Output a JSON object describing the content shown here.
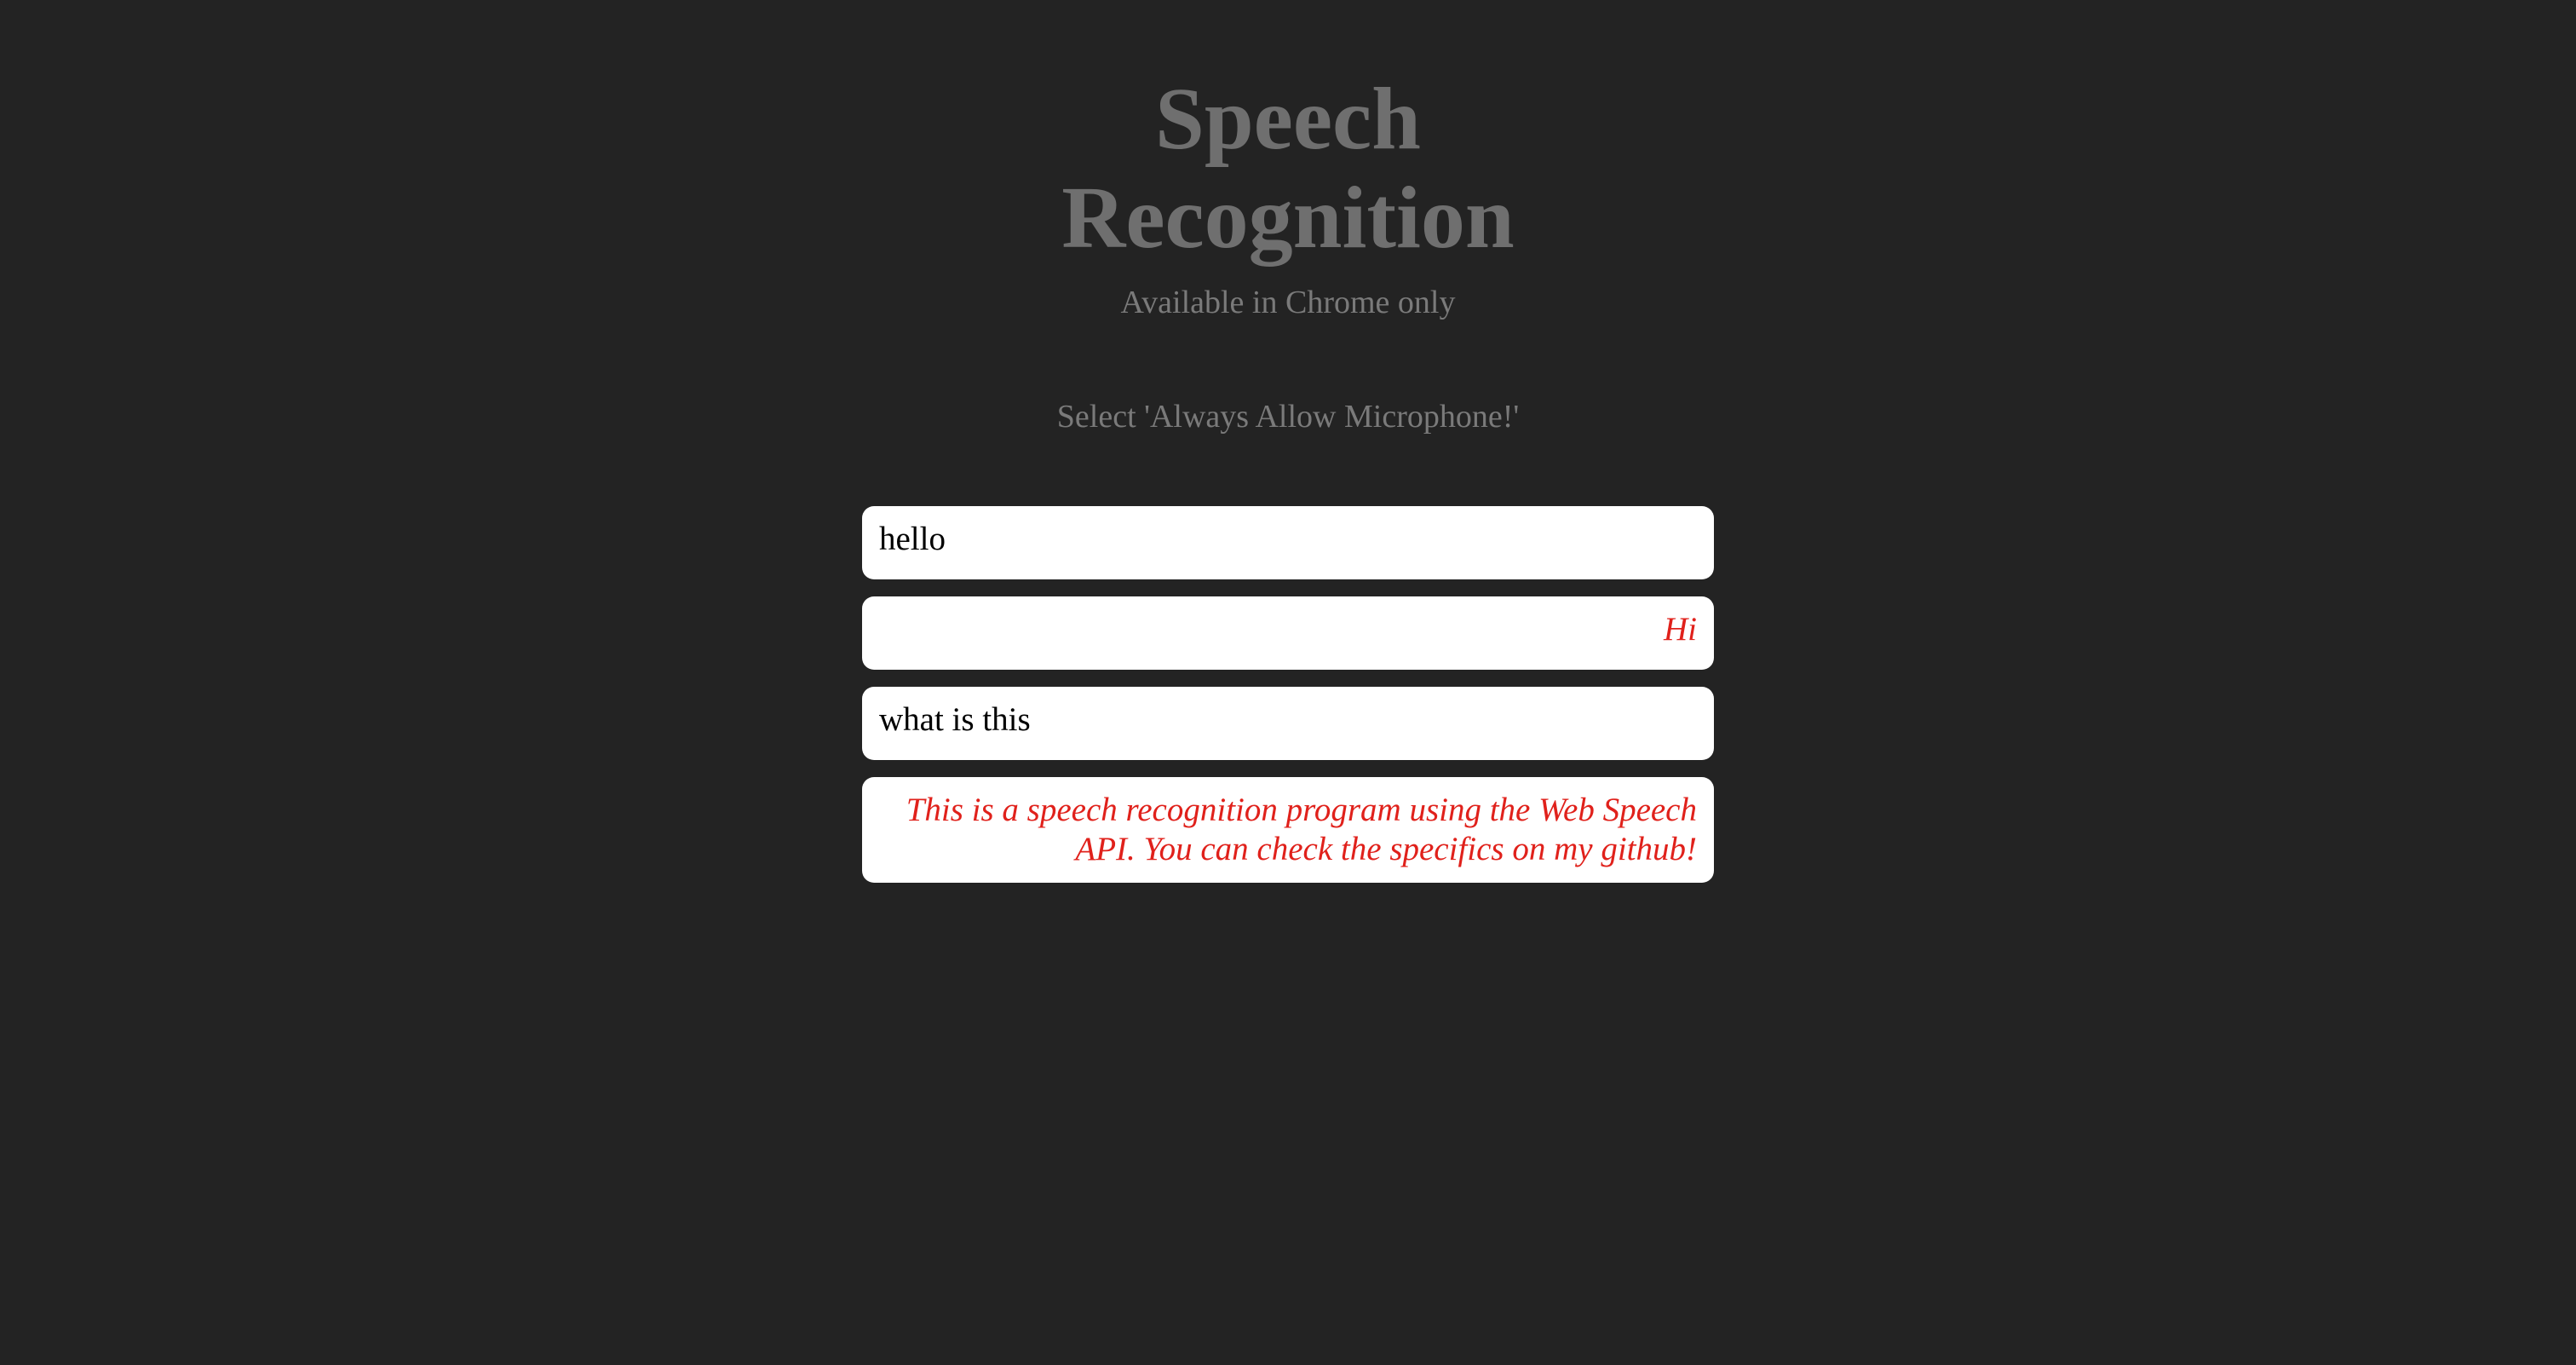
{
  "header": {
    "title_line1": "Speech",
    "title_line2": "Recognition",
    "subtitle": "Available in Chrome only"
  },
  "instruction": "Select 'Always Allow Microphone!'",
  "messages": [
    {
      "role": "user",
      "text": "hello"
    },
    {
      "role": "bot",
      "text": "Hi"
    },
    {
      "role": "user",
      "text": "what is this"
    },
    {
      "role": "bot",
      "text": "This is a speech recognition program using the Web Speech API. You can check the specifics on my github!"
    }
  ],
  "colors": {
    "background": "#232323",
    "heading": "#6f6f6f",
    "subtext": "#7a7a7a",
    "bubble": "#ffffff",
    "user_text": "#000000",
    "bot_text": "#e0211b"
  }
}
